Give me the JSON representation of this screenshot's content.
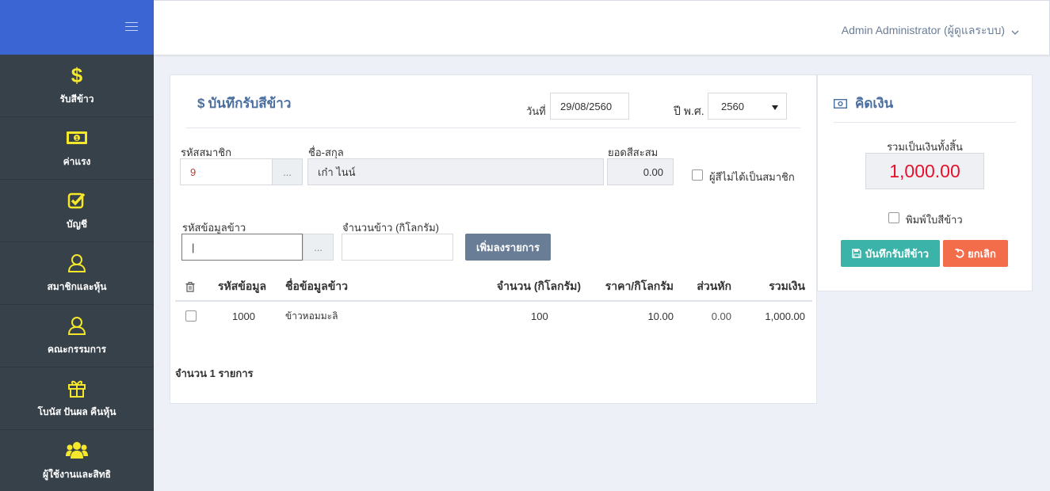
{
  "sidebar": {
    "items": [
      {
        "label": "รับสีข้าว",
        "icon": "dollar-icon"
      },
      {
        "label": "ค่าแรง",
        "icon": "money-bill-icon"
      },
      {
        "label": "บัญชี",
        "icon": "check-square-icon"
      },
      {
        "label": "สมาชิกและหุ้น",
        "icon": "user-outline-icon"
      },
      {
        "label": "คณะกรรมการ",
        "icon": "user-outline-icon"
      },
      {
        "label": "โบนัส ปันผล คืนหุ้น",
        "icon": "gift-icon"
      },
      {
        "label": "ผู้ใช้งานและสิทธิ",
        "icon": "users-icon"
      }
    ]
  },
  "header": {
    "user": "Admin Administrator (ผู้ดูแลระบบ)"
  },
  "form": {
    "title": "บันทึกรับสีข้าว",
    "date_label": "วันที่",
    "date_value": "29/08/2560",
    "year_label": "ปี พ.ศ.",
    "year_value": "2560",
    "member_code_label": "รหัสสมาชิก",
    "member_code_value": "9",
    "name_label": "ชื่อ-สกุล",
    "name_value": "เก๋า ไนน์",
    "accum_label": "ยอดสีสะสม",
    "accum_value": "0.00",
    "non_member_label": "ผู้สีไม่ได้เป็นสมาชิก",
    "rice_code_label": "รหัสข้อมูลข้าว",
    "rice_code_value": "|",
    "rice_qty_label": "จำนวนข้าว (กิโลกรัม)",
    "rice_qty_value": "",
    "dots": "...",
    "add_button": "เพิ่มลงรายการ"
  },
  "table": {
    "headers": [
      "รหัสข้อมูล",
      "ชื่อข้อมูลข้าว",
      "จำนวน (กิโลกรัม)",
      "ราคา/กิโลกรัม",
      "ส่วนหัก",
      "รวมเงิน"
    ],
    "rows": [
      {
        "code": "1000",
        "name": "ข้าวหอมมะลิ",
        "qty": "100",
        "price": "10.00",
        "deduct": "0.00",
        "total": "1,000.00"
      }
    ],
    "count_text": "จำนวน 1 รายการ"
  },
  "summary": {
    "title": "คิดเงิน",
    "total_label": "รวมเป็นเงินทั้งสิ้น",
    "total_value": "1,000.00",
    "print_label": "พิมพ์ใบสีข้าว",
    "save_button": "บันทึกรับสีข้าว",
    "cancel_button": "ยกเลิก"
  },
  "colors": {
    "sidebar_bg": "#37414a",
    "brand_bg": "#3c65d4",
    "icon_yellow": "#f5e72a",
    "save_btn": "#3bb3a8",
    "cancel_btn": "#f36d4a",
    "add_btn": "#6a7d96",
    "total_red": "#e8102c",
    "title_blue": "#4a6ea0"
  }
}
